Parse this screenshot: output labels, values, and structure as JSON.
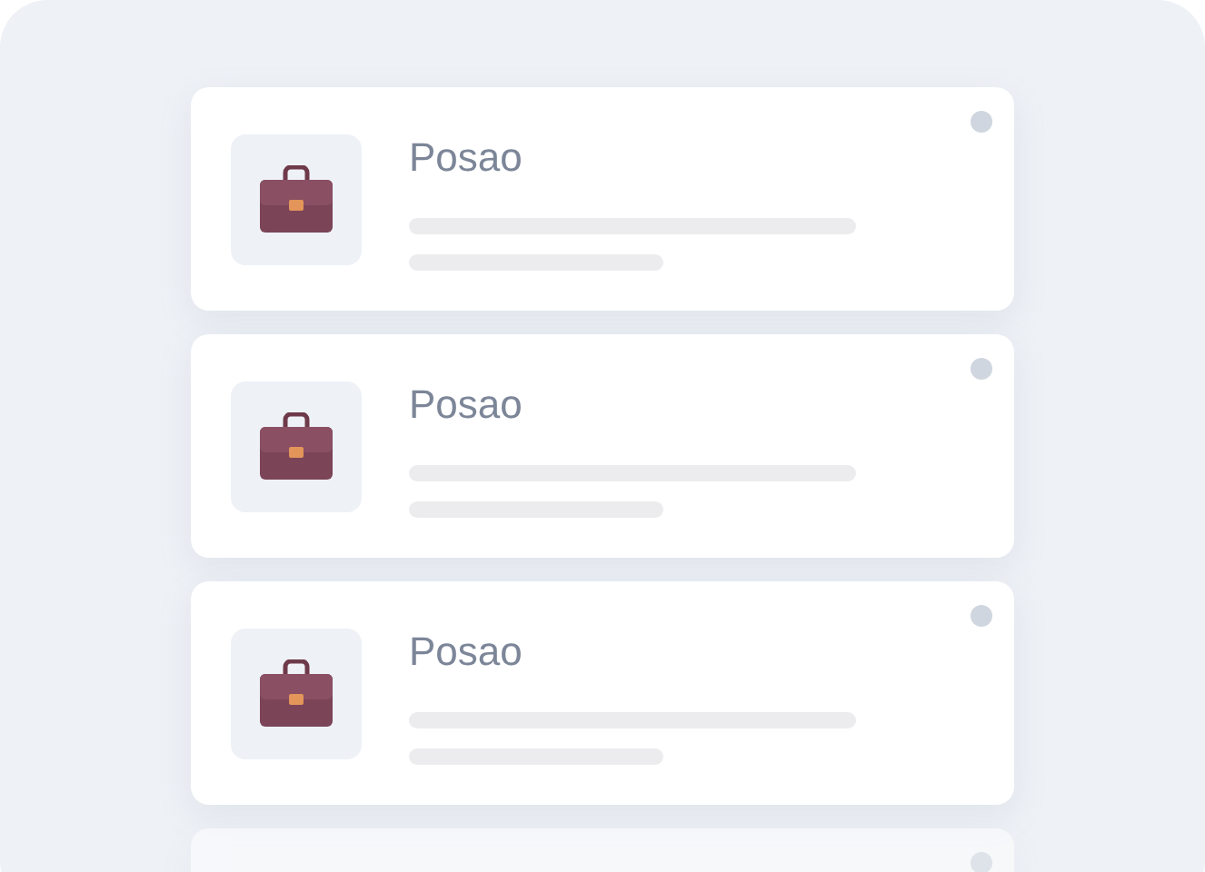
{
  "cards": [
    {
      "title": "Posao"
    },
    {
      "title": "Posao"
    },
    {
      "title": "Posao"
    }
  ]
}
